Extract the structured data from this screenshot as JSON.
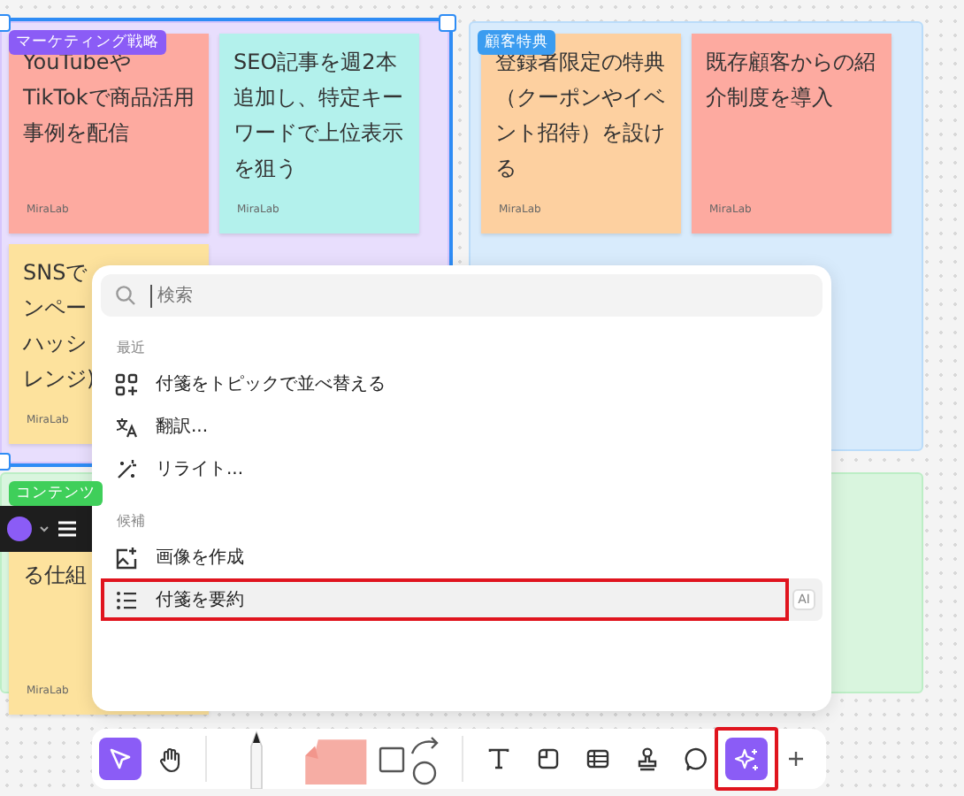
{
  "frames": [
    {
      "label": "マーケティング戦略",
      "color": "#8b5cf6",
      "selected": true,
      "notes": [
        {
          "lines": [
            "YouTubeやTikTokで商品活用事例を配信"
          ],
          "author": "MiraLab",
          "color": "#fdaaa0"
        },
        {
          "lines": [
            "SEO記事を週2本追加し、特定キーワードで上位表示を狙う"
          ],
          "author": "MiraLab",
          "color": "#b3f1ec"
        },
        {
          "lines": [
            "SNSで",
            "ンペー",
            "ハッシ",
            "レンジ)"
          ],
          "author": "MiraLab",
          "color": "#fde29d"
        }
      ]
    },
    {
      "label": "顧客特典",
      "color": "#3b9cf0",
      "selected": false,
      "notes": [
        {
          "lines": [
            "登録者限定の特典（クーポンやイベント招待）を設ける"
          ],
          "author": "MiraLab",
          "color": "#fdd0a0"
        },
        {
          "lines": [
            "既存顧客からの紹介制度を導入"
          ],
          "author": "MiraLab",
          "color": "#fdaaa0"
        }
      ]
    },
    {
      "label": "コンテンツ",
      "color": "#3fcf5a",
      "selected": false,
      "notes": [
        {
          "lines": [
            "る仕組"
          ],
          "author": "MiraLab",
          "color": "#fde29d"
        }
      ]
    }
  ],
  "menu": {
    "search": {
      "placeholder": "検索"
    },
    "sections": [
      {
        "title": "最近",
        "items": [
          {
            "label": "付箋をトピックで並べ替える",
            "selected": false,
            "highlighted": false
          },
          {
            "label": "翻訳...",
            "selected": false,
            "highlighted": false
          },
          {
            "label": "リライト...",
            "selected": false,
            "highlighted": false
          }
        ]
      },
      {
        "title": "候補",
        "items": [
          {
            "label": "画像を作成",
            "selected": false,
            "highlighted": false
          },
          {
            "label": "付箋を要約",
            "selected": true,
            "highlighted": true,
            "badge": "AI"
          }
        ]
      }
    ]
  },
  "toolbar": {
    "tools": [
      {
        "kind": "select",
        "selected": true,
        "highlighted": false
      },
      {
        "kind": "hand",
        "selected": false,
        "highlighted": false
      },
      {
        "kind": "divider"
      },
      {
        "kind": "pen",
        "selected": false,
        "highlighted": false
      },
      {
        "kind": "sticky",
        "selected": false,
        "highlighted": false
      },
      {
        "kind": "shapes",
        "selected": false,
        "highlighted": false
      },
      {
        "kind": "divider"
      },
      {
        "kind": "text",
        "selected": false,
        "highlighted": false
      },
      {
        "kind": "frame",
        "selected": false,
        "highlighted": false
      },
      {
        "kind": "table",
        "selected": false,
        "highlighted": false
      },
      {
        "kind": "stamp",
        "selected": false,
        "highlighted": false
      },
      {
        "kind": "comment",
        "selected": false,
        "highlighted": false
      },
      {
        "kind": "ai",
        "selected": true,
        "highlighted": true
      },
      {
        "kind": "plus",
        "selected": false,
        "highlighted": false
      }
    ]
  }
}
